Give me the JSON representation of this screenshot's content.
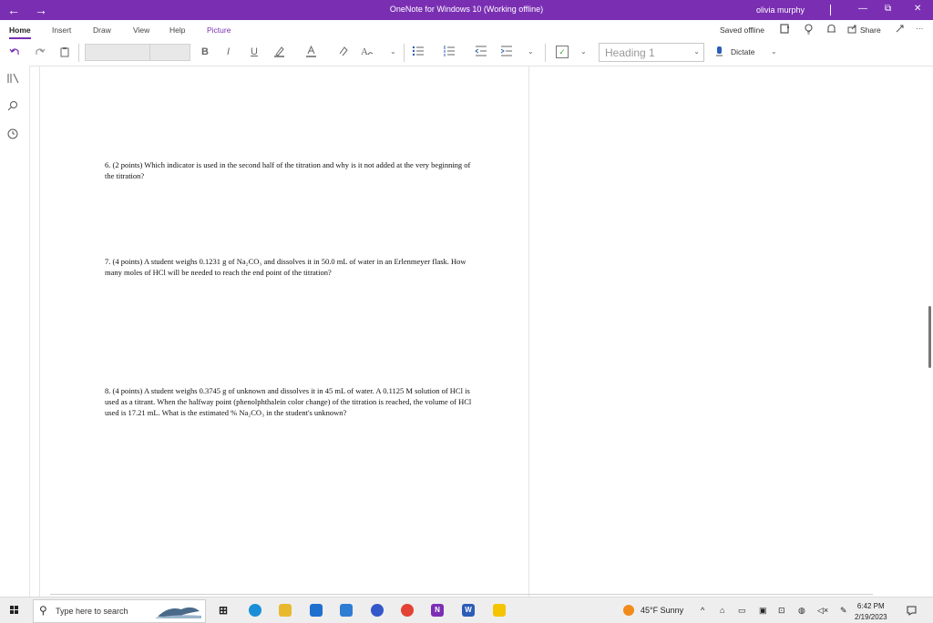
{
  "window": {
    "title": "OneNote for Windows 10 (Working offline)",
    "user": "olivia murphy",
    "back": "←",
    "forward": "→",
    "minimize": "—",
    "maximize": "⧉",
    "close": "✕"
  },
  "ribbon": {
    "tabs": [
      "Home",
      "Insert",
      "Draw",
      "View",
      "Help",
      "Picture"
    ],
    "saved": "Saved offline",
    "share": "Share",
    "more": "···"
  },
  "toolbar": {
    "bold": "B",
    "italic": "I",
    "underline": "U",
    "style": "Heading 1",
    "dictate": "Dictate"
  },
  "page": {
    "questions": [
      "6. (2 points) Which indicator is used in the second half of the titration and why is it not added at the very beginning of the titration?",
      "7. (4 points) A student weighs 0.1231 g of Na₂CO₃ and dissolves it in 50.0 mL of water in an Erlenmeyer flask. How many moles of HCl will be needed to reach the end point of the titration?",
      "8. (4 points) A student weighs 0.3745 g of unknown and dissolves it in 45 mL of water. A 0.1125 M solution of HCl is used as a titrant. When the halfway point (phenolphthalein color change) of the titration is reached, the volume of HCl used is 17.21 mL. What is the estimated % Na₂CO₃ in the student's unknown?"
    ]
  },
  "taskbar": {
    "search_placeholder": "Type here to search",
    "weather": "45°F  Sunny",
    "time": "6:42 PM",
    "date": "2/19/2023",
    "apps": [
      {
        "name": "onenote-app",
        "label": "N",
        "color": "#7b2fb4"
      },
      {
        "name": "word-app",
        "label": "W",
        "color": "#2b5cb8"
      }
    ]
  },
  "colors": {
    "accent": "#7a2fb3",
    "taskbar": "#eeeeee"
  }
}
